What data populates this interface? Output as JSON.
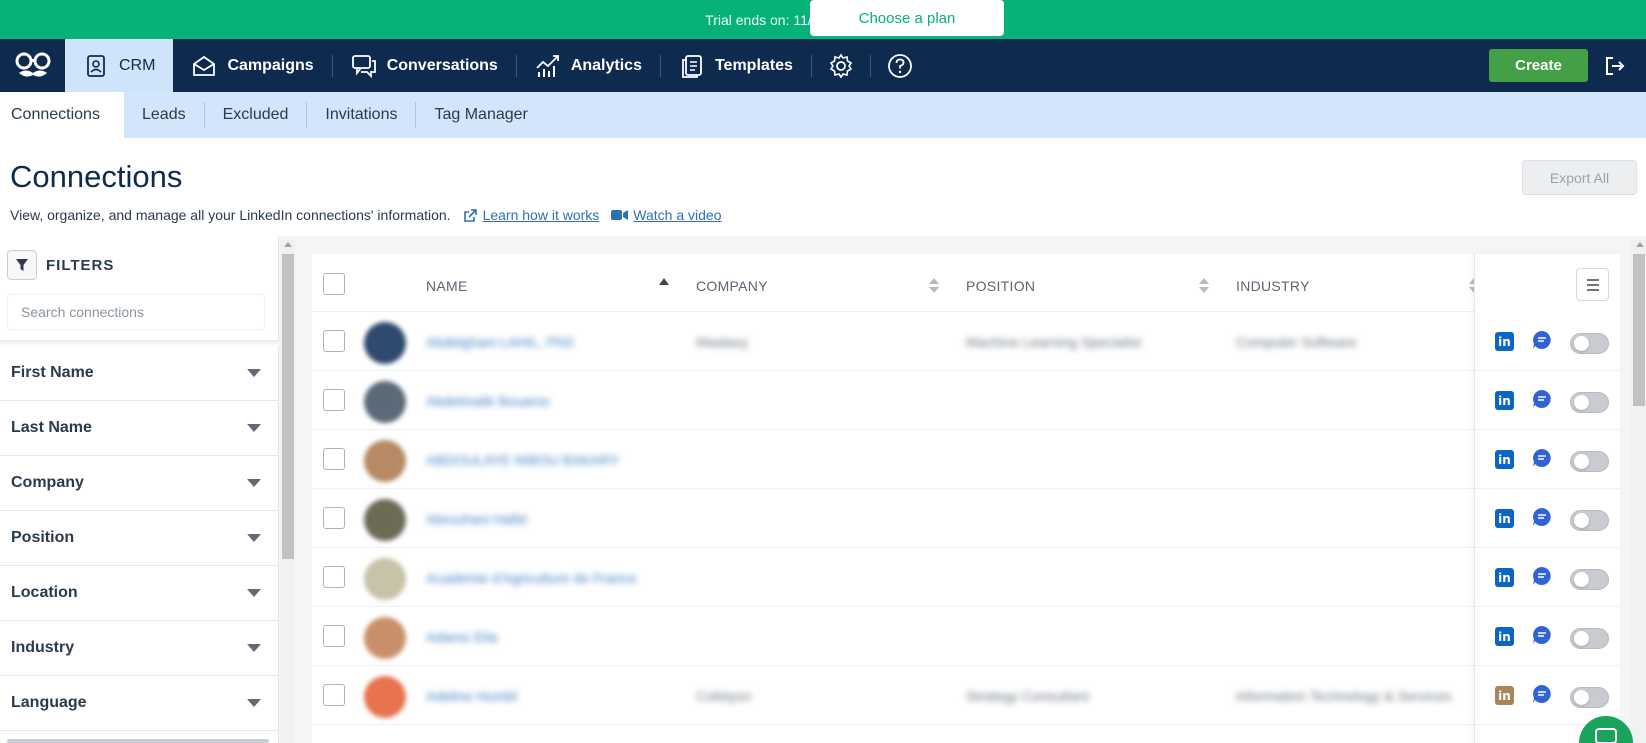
{
  "trial": {
    "text": "Trial ends on: 11/25/24",
    "button": "Choose a plan"
  },
  "nav": {
    "items": [
      {
        "label": "CRM",
        "icon": "contacts-icon"
      },
      {
        "label": "Campaigns",
        "icon": "mail-icon"
      },
      {
        "label": "Conversations",
        "icon": "chat-icon"
      },
      {
        "label": "Analytics",
        "icon": "analytics-icon"
      },
      {
        "label": "Templates",
        "icon": "templates-icon"
      }
    ],
    "create": "Create"
  },
  "subtabs": [
    "Connections",
    "Leads",
    "Excluded",
    "Invitations",
    "Tag Manager"
  ],
  "page": {
    "title": "Connections",
    "subtitle": "View, organize, and manage all your LinkedIn connections' information.",
    "learn_link": "Learn how it works",
    "video_link": "Watch a video",
    "export": "Export All"
  },
  "filters": {
    "title": "FILTERS",
    "search_placeholder": "Search connections",
    "items": [
      "First Name",
      "Last Name",
      "Company",
      "Position",
      "Location",
      "Industry",
      "Language"
    ]
  },
  "table": {
    "columns": [
      "NAME",
      "COMPANY",
      "POSITION",
      "INDUSTRY"
    ],
    "rows": [
      {
        "name": "Abdelghani LAHIL, PhD",
        "company": "Maalaxy",
        "position": "Machine Learning Specialist",
        "industry": "Computer Software",
        "avatar": "#2f4a6e",
        "li": "in"
      },
      {
        "name": "Abdelmalik Bouarss",
        "company": "",
        "position": "",
        "industry": "",
        "avatar": "#5b6a78",
        "li": "in"
      },
      {
        "name": "ABDOULAYE NIBOU BAKARY",
        "company": "",
        "position": "",
        "industry": "",
        "avatar": "#b58a64",
        "li": "in"
      },
      {
        "name": "Abrouhani Hafid",
        "company": "",
        "position": "",
        "industry": "",
        "avatar": "#6d6a55",
        "li": "in"
      },
      {
        "name": "Académie d'Agriculture de France",
        "company": "",
        "position": "",
        "industry": "",
        "avatar": "#c7c2a8",
        "li": "in"
      },
      {
        "name": "Adamo Elia",
        "company": "",
        "position": "",
        "industry": "",
        "avatar": "#c98f6a",
        "li": "in"
      },
      {
        "name": "Adeline Humbl",
        "company": "Cofelyon",
        "position": "Strategy Consultant",
        "industry": "Information Technology & Services",
        "avatar": "#e7734f",
        "li": "in"
      }
    ]
  }
}
